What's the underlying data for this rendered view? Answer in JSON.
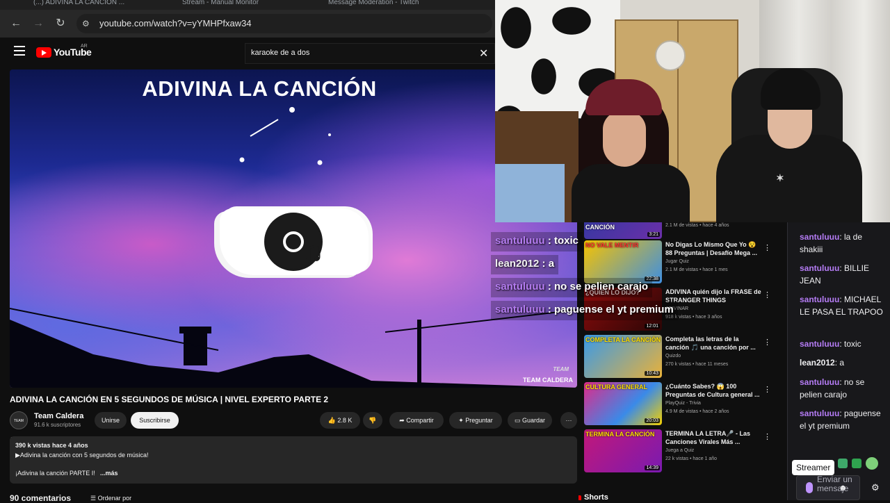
{
  "browser": {
    "url": "youtube.com/watch?v=yYMHPfxaw34",
    "tabs": [
      "(...) ADIVINA LA CANCIÓN ...",
      "Stream - Manual Monitor",
      "Message Moderation - Twitch"
    ]
  },
  "youtube": {
    "logo_text": "YouTube",
    "country_code": "AR",
    "search_value": "karaoke de a dos",
    "video": {
      "overlay_title": "ADIVINA LA CANCIÓN",
      "watermark_small": "TEAM",
      "watermark": "TEAM CALDERA",
      "title": "ADIVINA LA CANCIÓN EN 5 SEGUNDOS DE MÚSICA | NIVEL EXPERTO PARTE 2",
      "channel": "Team Caldera",
      "subscribers": "91.6 k suscriptores",
      "avatar_text": "TEAM CALDERA",
      "join_label": "Unirse",
      "subscribe_label": "Suscribirse",
      "likes": "2.8 K",
      "share_label": "Compartir",
      "ask_label": "Preguntar",
      "save_label": "Guardar",
      "more_label": "···"
    },
    "description": {
      "meta": "390 k vistas  hace 4 años",
      "line1": "▶Adivina la canción con 5 segundos de música!",
      "line2": "¡Adivina la canción PARTE I!",
      "more": "...más"
    },
    "comments": {
      "count": "90 comentarios",
      "sort_label": "Ordenar por"
    },
    "recommendations": [
      {
        "thumb": "CANCIÓN",
        "duration": "3:21",
        "title": "",
        "channel": "",
        "meta": "2.1 M de vistas • hace 4 años"
      },
      {
        "thumb": "NO VALE MENTIR",
        "duration": "22:38",
        "title": "No Digas Lo Mismo Que Yo 😵 88 Preguntas | Desafío Mega ...",
        "channel": "Jugar Quiz",
        "meta": "2.1 M de vistas • hace 1 mes"
      },
      {
        "thumb": "¿QUIÉN LO DIJO?",
        "duration": "12:01",
        "title": "ADIVINA quién dijo la FRASE de STRANGER THINGS",
        "channel": "ADIVINAR",
        "meta": "918 k vistas • hace 3 años"
      },
      {
        "thumb": "COMPLETA LA CANCIÓN",
        "duration": "10:43",
        "title": "Completa las letras de la canción 🎵 una canción por ...",
        "channel": "Quizdo",
        "meta": "270 k vistas • hace 11 meses"
      },
      {
        "thumb": "CULTURA GENERAL",
        "duration": "20:03",
        "title": "¿Cuánto Sabes? 😱 100 Preguntas de Cultura general ...",
        "channel": "PlayQuiz - Trivia",
        "meta": "4.9 M de vistas • hace 2 años"
      },
      {
        "thumb": "TERMINA LA CANCIÓN",
        "duration": "14:39",
        "title": "TERMINA LA LETRA🎤 - Las Canciones Virales Más ...",
        "channel": "Juega a Quiz",
        "meta": "22 k vistas • hace 1 año"
      }
    ],
    "shorts_label": "Shorts"
  },
  "stream_overlay": [
    {
      "user": "santuluuu",
      "text": " : toxic"
    },
    {
      "user": "lean2012",
      "text": " : a"
    },
    {
      "user": "santuluuu",
      "text": " : no se pelien carajo"
    },
    {
      "user": "santuluuu",
      "text": " : paguense el yt premium"
    }
  ],
  "chat": {
    "messages": [
      {
        "user": "santuluuu",
        "text": ": la de shakiii"
      },
      {
        "user": "santuluuu",
        "text": ": BILLIE JEAN"
      },
      {
        "user": "santuluuu",
        "text": ": MICHAEL LE PASA EL TRAPOO"
      },
      {
        "user": "santuluuu",
        "text": ": toxic"
      },
      {
        "user": "lean2012",
        "text": ": a"
      },
      {
        "user": "santuluuu",
        "text": ": no se pelien carajo"
      },
      {
        "user": "santuluuu",
        "text": ": paguense el yt premium"
      }
    ],
    "tooltip": "Streamer",
    "input_placeholder": "Enviar un mensaje"
  },
  "colors": {
    "youtube_red": "#ff0000",
    "twitch_purple": "#b57cf5",
    "chat_bg": "#18181b"
  }
}
